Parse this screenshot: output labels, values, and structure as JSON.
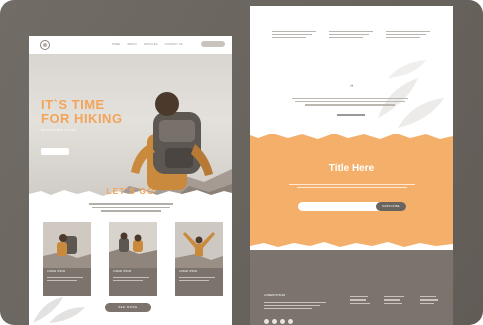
{
  "left_page": {
    "nav": {
      "links": [
        "HOME",
        "ABOUT",
        "ARTICLES",
        "CONTACT US"
      ]
    },
    "hero": {
      "title_line1": "IT`S TIME",
      "title_line2": "FOR HIKING",
      "subtitle": "ADVENTURE CLASS"
    },
    "section_title": "LET`S GO",
    "cards": [
      {
        "title": "LOREM IPSUM"
      },
      {
        "title": "LOREM IPSUM"
      },
      {
        "title": "LOREM IPSUM"
      }
    ],
    "button_label": "SEE MORE"
  },
  "right_page": {
    "quote_mark": "“",
    "cta_title": "Title Here",
    "subscribe_button": "SUBSCRIBE",
    "footer_title": "LOREM IPSUM"
  },
  "colors": {
    "accent": "#f2a45a",
    "orange_band": "#f4b06b",
    "taupe": "#7b736c",
    "background": "#6a645e"
  }
}
